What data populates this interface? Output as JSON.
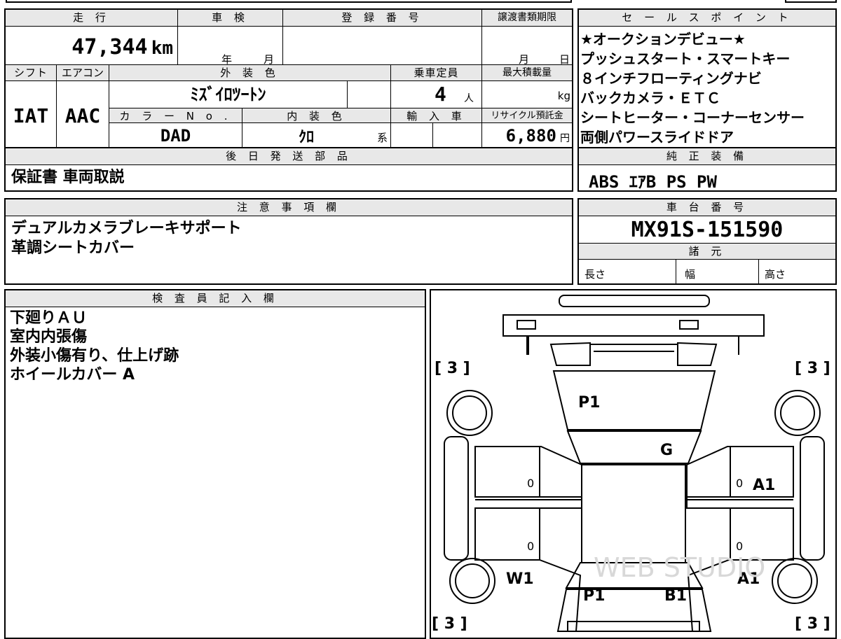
{
  "headers": {
    "mileage": "走 行",
    "shaken": "車 検",
    "reg_number": "登 録 番 号",
    "transfer_deadline": "譲渡書類期限",
    "shift": "シフト",
    "aircon": "エアコン",
    "exterior_color": "外 装 色",
    "capacity": "乗車定員",
    "max_load": "最大積載量",
    "color_no": "カ ラ ー N o .",
    "interior_color": "内 装 色",
    "import": "輸 入 車",
    "recycle": "リサイクル預託金",
    "later_parts": "後 日 発 送 部 品",
    "notes": "注 意 事 項 欄",
    "sales_points": "セ ー ル ス ポ イ ン ト",
    "genuine_equipment": "純 正 装 備",
    "chassis_number": "車 台 番 号",
    "specs": "諸 元",
    "inspector": "検 査 員 記 入 欄"
  },
  "values": {
    "mileage": "47,344",
    "mileage_unit": "km",
    "shaken_year_unit": "年",
    "shaken_month_unit": "月",
    "deadline_month_unit": "月",
    "deadline_day_unit": "日",
    "shift": "IAT",
    "aircon": "AAC",
    "exterior_color": "ﾐｽﾞｲﾛﾂｰﾄﾝ",
    "capacity": "4",
    "capacity_unit": "人",
    "max_load_unit": "kg",
    "color_no": "DAD",
    "interior_color": "ｸﾛ",
    "interior_suffix": "系",
    "recycle_fee": "6,880",
    "recycle_unit": "円",
    "later_parts": "保証書 車両取説",
    "chassis_number": "MX91S-151590",
    "spec_length": "長さ",
    "spec_width": "幅",
    "spec_height": "高さ"
  },
  "sales_points": [
    "★オークションデビュー★",
    "プッシュスタート・スマートキー",
    "８インチフローティングナビ",
    "バックカメラ・ＥＴＣ",
    "シートヒーター・コーナーセンサー",
    "両側パワースライドドア"
  ],
  "genuine_equipment": "ABS ｴｱB PS PW",
  "notes": [
    "デュアルカメラブレーキサポート",
    "革調シートカバー"
  ],
  "inspector_notes": [
    "下廻りＡＵ",
    "室内内張傷",
    "外装小傷有り、仕上げ跡",
    "ホイールカバー A"
  ],
  "diagram": {
    "tire_label": "[ 3 ]",
    "marks": {
      "hood": "P1",
      "windshield": "G",
      "right_front_fender": "A1",
      "left_rear_wheel": "W1",
      "right_rear": "A1",
      "rear_left": "P1",
      "rear_right": "B1",
      "left_front_door": "0",
      "left_rear_door": "0",
      "right_front_door": "0",
      "right_rear_door": "0"
    },
    "watermark": "WEB STUDIO"
  }
}
